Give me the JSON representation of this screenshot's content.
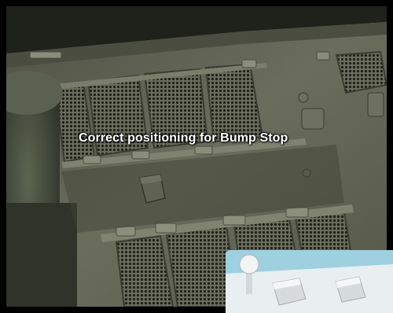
{
  "caption": {
    "text": "Correct positioning for Bump Stop"
  },
  "colors": {
    "frame": "#000000",
    "hull_base": "#5e6150",
    "hull_dark": "#3a3c31",
    "caption_text": "#ffffff",
    "inset_background": "#9fd0df"
  }
}
